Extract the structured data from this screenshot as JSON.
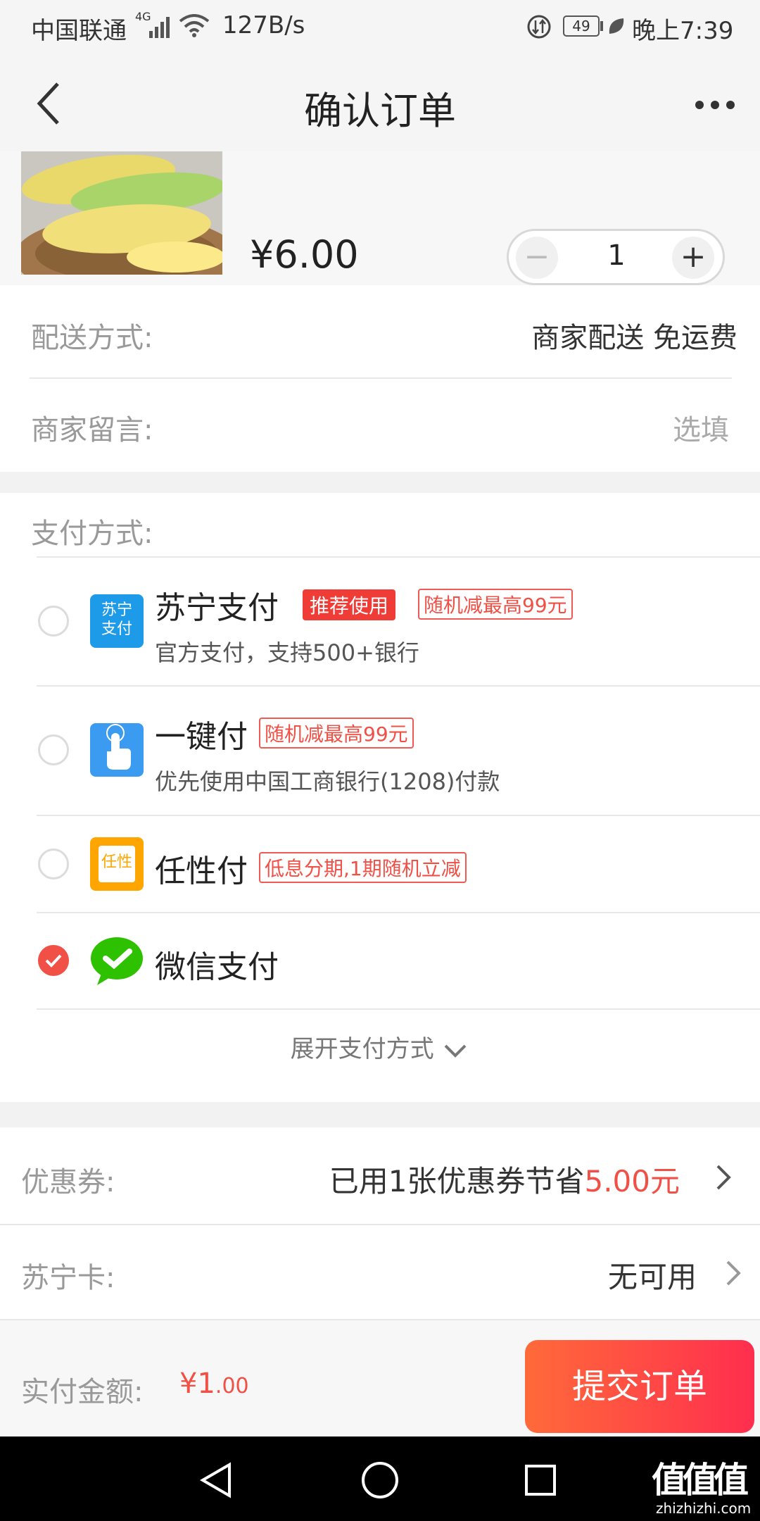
{
  "status_bar": {
    "carrier": "中国联通",
    "network": "4G",
    "speed": "127B/s",
    "battery": "49",
    "time": "晚上7:39"
  },
  "header": {
    "title": "确认订单"
  },
  "product": {
    "price": "¥6.00",
    "quantity": "1"
  },
  "delivery": {
    "label": "配送方式:",
    "value": "商家配送 免运费"
  },
  "message": {
    "label": "商家留言:",
    "placeholder": "选填"
  },
  "payment": {
    "label": "支付方式:",
    "options": [
      {
        "name": "苏宁支付",
        "tag_solid": "推荐使用",
        "tag_outline": "随机减最高99元",
        "desc": "官方支付，支持500+银行",
        "icon_text": "苏宁支付",
        "selected": false
      },
      {
        "name": "一键付",
        "tag_outline": "随机减最高99元",
        "desc": "优先使用中国工商银行(1208)付款",
        "selected": false
      },
      {
        "name": "任性付",
        "tag_outline": "低息分期,1期随机立减",
        "icon_text": "任性",
        "selected": false
      },
      {
        "name": "微信支付",
        "selected": true
      }
    ],
    "expand_label": "展开支付方式"
  },
  "coupon": {
    "label": "优惠券:",
    "value_prefix": "已用1张优惠券节省",
    "value_amount": "5.00元"
  },
  "card": {
    "label": "苏宁卡:",
    "value": "无可用"
  },
  "footer": {
    "label": "实付金额:",
    "amount_main": "¥1",
    "amount_decimal": ".00",
    "submit_label": "提交订单"
  },
  "watermark": {
    "logo": "值值值",
    "url": "zhizhizhi.com"
  },
  "colors": {
    "accent_red": "#f05046",
    "submit_gradient_start": "#ff6a3a",
    "submit_gradient_end": "#ff2e4e",
    "suning_blue": "#1e9be8",
    "wechat_green": "#2dc100",
    "renxing_orange": "#ffa500"
  }
}
